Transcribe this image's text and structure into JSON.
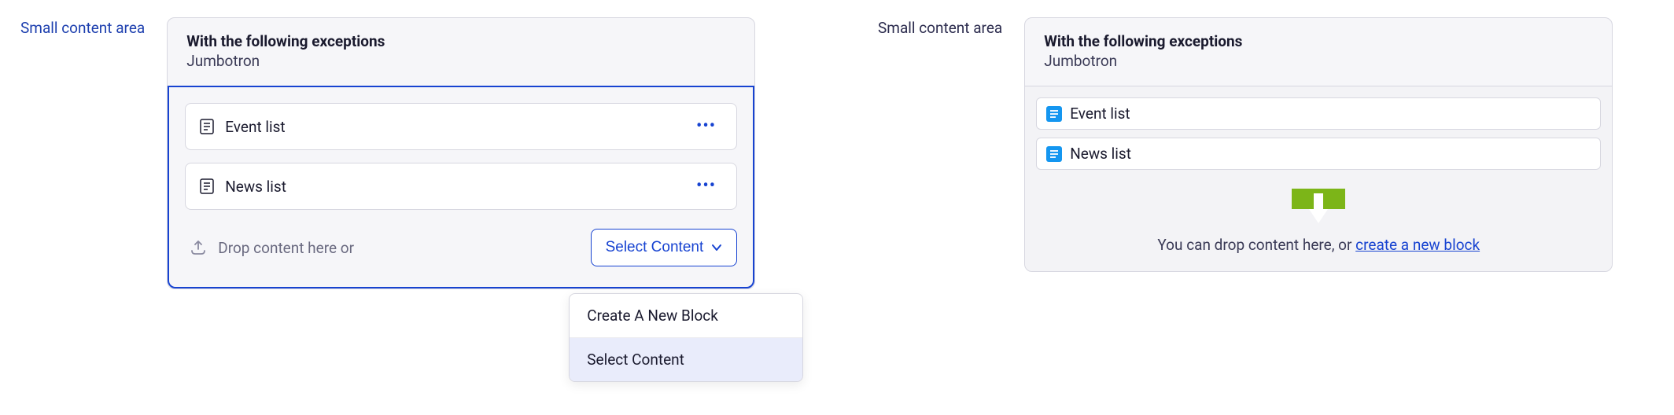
{
  "left": {
    "label": "Small content area",
    "card": {
      "title": "With the following exceptions",
      "subtitle": "Jumbotron"
    },
    "items": [
      {
        "label": "Event list"
      },
      {
        "label": "News list"
      }
    ],
    "drop_text": "Drop content here or",
    "select_button": "Select Content",
    "menu": {
      "create": "Create A New Block",
      "select": "Select Content"
    }
  },
  "right": {
    "label": "Small content area",
    "card": {
      "title": "With the following exceptions",
      "subtitle": "Jumbotron"
    },
    "items": [
      {
        "label": "Event list"
      },
      {
        "label": "News list"
      }
    ],
    "drop_prefix": "You can drop content here, or ",
    "drop_link": "create a new block"
  }
}
